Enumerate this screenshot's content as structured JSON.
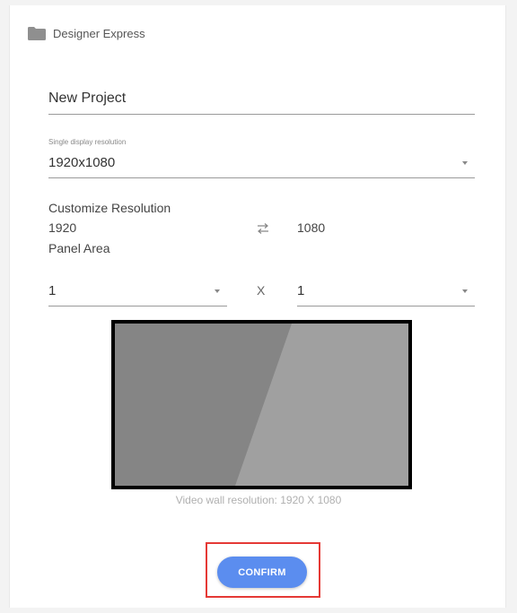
{
  "app": {
    "title": "Designer Express",
    "icon": "folder-icon"
  },
  "project": {
    "name_value": "New Project"
  },
  "display_resolution": {
    "label": "Single display resolution",
    "selected": "1920x1080"
  },
  "custom_resolution": {
    "label": "Customize Resolution",
    "width": "1920",
    "height": "1080",
    "swap_icon": "swap-arrows-icon"
  },
  "panel_area": {
    "label": "Panel Area",
    "columns": "1",
    "separator": "X",
    "rows": "1"
  },
  "preview": {
    "caption": "Video wall resolution: 1920 X 1080"
  },
  "actions": {
    "confirm_label": "CONFIRM"
  },
  "colors": {
    "confirm_button": "#5b8def",
    "highlight_frame": "#e53935"
  }
}
